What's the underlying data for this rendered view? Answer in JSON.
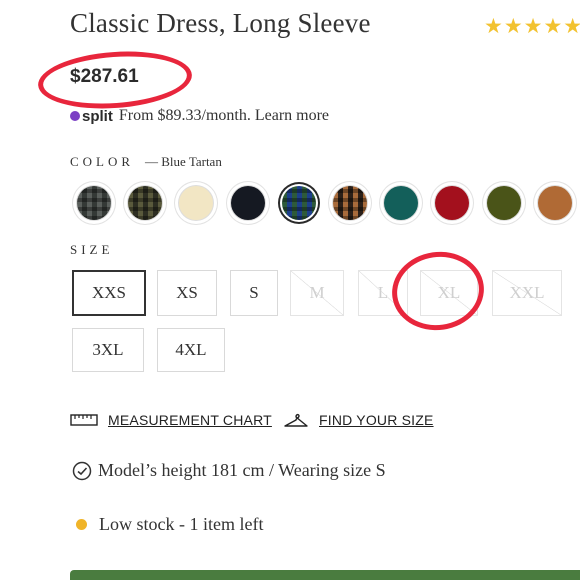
{
  "product": {
    "title": "Classic Dress, Long Sleeve",
    "rating_stars": "★★★★★",
    "price": "$287.61"
  },
  "installments": {
    "provider_text": "split",
    "text": "From $89.33/month. Learn more"
  },
  "color": {
    "label": "COLOR",
    "selected_value": "— Blue Tartan",
    "swatches": [
      {
        "name": "grey-tartan",
        "colors": [
          "#5a5f5c",
          "#343936"
        ]
      },
      {
        "name": "olive-tartan",
        "colors": [
          "#5a5a3c",
          "#2d2e22"
        ]
      },
      {
        "name": "cream",
        "colors": [
          "#f2e6c4",
          "#f2e6c4"
        ]
      },
      {
        "name": "black",
        "colors": [
          "#151922",
          "#151922"
        ]
      },
      {
        "name": "blue-tartan",
        "colors": [
          "#2d5a3a",
          "#1d3f8a"
        ]
      },
      {
        "name": "brown-tartan",
        "colors": [
          "#a86b3b",
          "#2b2019"
        ]
      },
      {
        "name": "teal",
        "colors": [
          "#135f5a",
          "#135f5a"
        ]
      },
      {
        "name": "red",
        "colors": [
          "#a3101d",
          "#a3101d"
        ]
      },
      {
        "name": "olive",
        "colors": [
          "#4a5418",
          "#4a5418"
        ]
      },
      {
        "name": "caramel",
        "colors": [
          "#b06a35",
          "#b06a35"
        ]
      }
    ]
  },
  "size": {
    "label": "SIZE",
    "options": [
      {
        "label": "XXS",
        "state": "selected"
      },
      {
        "label": "XS",
        "state": "available"
      },
      {
        "label": "S",
        "state": "available"
      },
      {
        "label": "M",
        "state": "unavailable"
      },
      {
        "label": "L",
        "state": "unavailable"
      },
      {
        "label": "XL",
        "state": "unavailable"
      },
      {
        "label": "XXL",
        "state": "unavailable"
      },
      {
        "label": "3XL",
        "state": "available"
      },
      {
        "label": "4XL",
        "state": "available"
      }
    ]
  },
  "links": {
    "measurement_chart": "MEASUREMENT CHART",
    "find_your_size": "FIND YOUR SIZE"
  },
  "model_info": "Model’s height 181 cm / Wearing size S",
  "stock": {
    "text": "Low stock - 1 item left",
    "dot_color": "#f0b429"
  },
  "annotation_color": "#e8263c"
}
